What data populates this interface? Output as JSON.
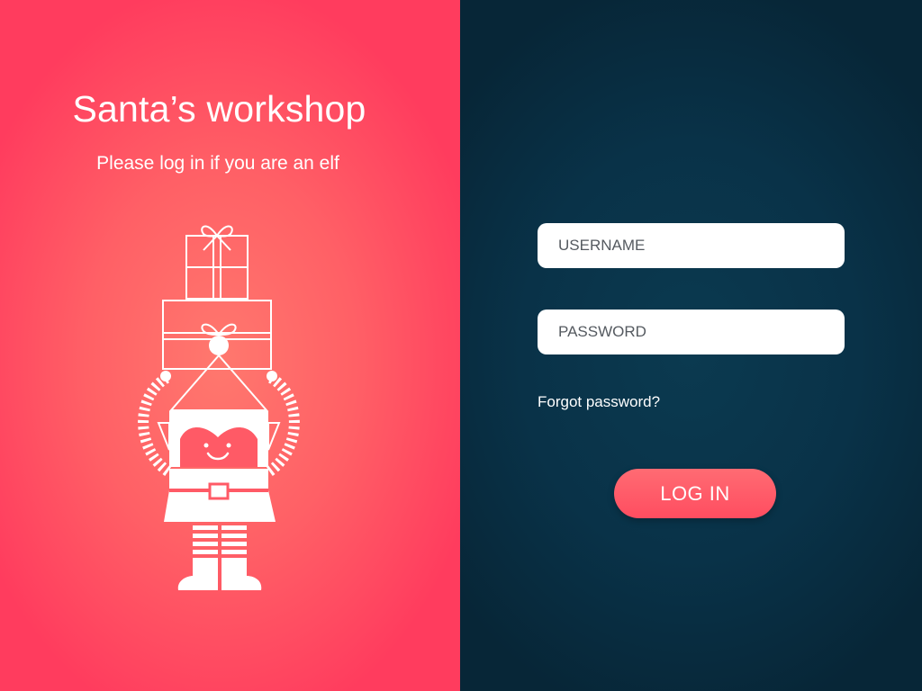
{
  "intro": {
    "title": "Santa’s workshop",
    "subtitle": "Please log in if you are an elf"
  },
  "illustration": {
    "icon": "elf-carrying-gifts-icon"
  },
  "login_form": {
    "username_placeholder": "USERNAME",
    "password_placeholder": "PASSWORD",
    "forgot_password_label": "Forgot password?",
    "submit_label": "LOG IN"
  },
  "colors": {
    "left_background": "#ff5a66",
    "right_background": "#0a3146",
    "button": "#ff5a68",
    "text": "#ffffff"
  }
}
